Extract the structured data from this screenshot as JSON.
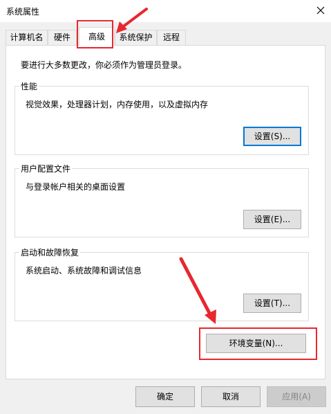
{
  "window": {
    "title": "系统属性"
  },
  "tabs": [
    {
      "label": "计算机名",
      "active": false
    },
    {
      "label": "硬件",
      "active": false
    },
    {
      "label": "高级",
      "active": true
    },
    {
      "label": "系统保护",
      "active": false
    },
    {
      "label": "远程",
      "active": false
    }
  ],
  "advanced": {
    "intro": "要进行大多数更改，你必须作为管理员登录。",
    "performance": {
      "title": "性能",
      "description": "视觉效果，处理器计划，内存使用，以及虚拟内存",
      "button": "设置(S)..."
    },
    "user_profiles": {
      "title": "用户配置文件",
      "description": "与登录帐户相关的桌面设置",
      "button": "设置(E)..."
    },
    "startup_recovery": {
      "title": "启动和故障恢复",
      "description": "系统启动、系统故障和调试信息",
      "button": "设置(T)..."
    },
    "env_button": "环境变量(N)..."
  },
  "footer": {
    "ok": "确定",
    "cancel": "取消",
    "apply": "应用(A)"
  },
  "colors": {
    "highlight": "#e8272e",
    "focus": "#0078d7"
  },
  "icons": {
    "close": "close-icon",
    "annotation": "arrow-icon"
  }
}
